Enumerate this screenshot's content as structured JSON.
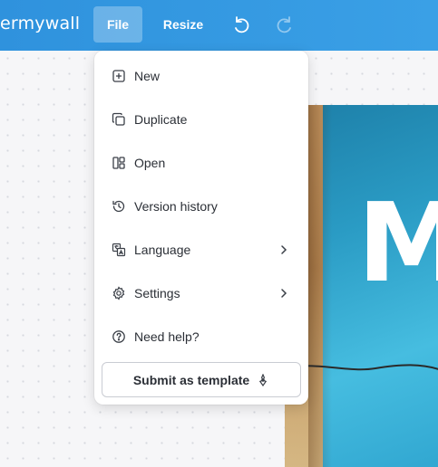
{
  "topbar": {
    "brand": "ermywall",
    "file_label": "File",
    "resize_label": "Resize",
    "undo_icon": "undo-icon",
    "redo_icon": "redo-icon"
  },
  "menu": {
    "items": [
      {
        "label": "New",
        "icon": "plus-square-icon"
      },
      {
        "label": "Duplicate",
        "icon": "duplicate-icon"
      },
      {
        "label": "Open",
        "icon": "open-layout-icon"
      },
      {
        "label": "Version history",
        "icon": "history-icon"
      },
      {
        "label": "Language",
        "icon": "language-icon",
        "submenu": true
      },
      {
        "label": "Settings",
        "icon": "gear-icon",
        "submenu": true
      },
      {
        "label": "Need help?",
        "icon": "help-icon"
      }
    ],
    "submit_label": "Submit as template",
    "submit_icon": "template-sparkle-icon"
  },
  "colors": {
    "topbar": "#3aa0e6",
    "menu_text": "#2b2f36"
  }
}
